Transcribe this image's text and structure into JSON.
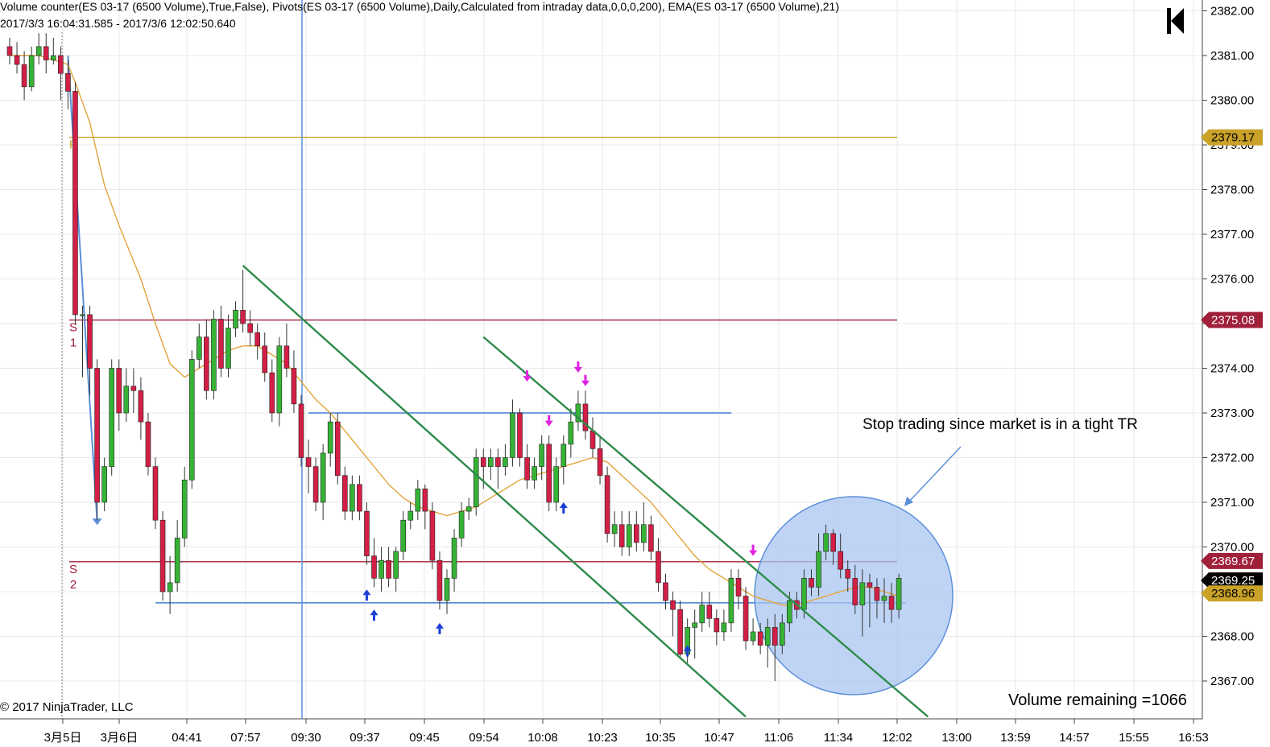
{
  "header": {
    "indicators": "Volume counter(ES 03-17 (6500 Volume),True,False), Pivots(ES 03-17 (6500 Volume),Daily,Calculated from intraday data,0,0,0,200), EMA(ES 03-17 (6500 Volume),21)",
    "range": "2017/3/3 16:04:31.585 - 2017/3/6 12:02:50.640"
  },
  "footer": {
    "copyright": "© 2017 NinjaTrader, LLC",
    "volume_remaining": "Volume remaining =1066"
  },
  "annotation": "Stop trading since market is in a tight TR",
  "logo_icon": "ninjatrader-logo-icon",
  "colors": {
    "up": "#36b336",
    "down": "#d31f46",
    "ema": "#e2a43c",
    "pivot_p": "#c9a227",
    "pivot_s": "#a0203a",
    "blue_line": "#5b8fd9",
    "channel": "#2e8b4b",
    "marker_up": "#1a3fd6",
    "marker_down": "#e020e0",
    "circle_fill": "#a9c6f0",
    "last_price_bg": "#000000"
  },
  "chart_data": {
    "type": "candlestick",
    "symbol": "ES 03-17 (6500 Volume)",
    "y_range": [
      2366.2,
      2382.2
    ],
    "y_ticks": [
      2367,
      2368,
      2369,
      2370,
      2371,
      2372,
      2373,
      2374,
      2375,
      2376,
      2377,
      2378,
      2379,
      2380,
      2381,
      2382
    ],
    "x_ticks": [
      "3月5日",
      "3月6日",
      "04:41",
      "07:57",
      "09:30",
      "09:37",
      "09:45",
      "09:54",
      "10:08",
      "10:23",
      "10:35",
      "10:47",
      "11:06",
      "11:34",
      "12:02",
      "13:00",
      "13:59",
      "14:57",
      "15:55",
      "16:53"
    ],
    "pivots": [
      {
        "label": "P",
        "value": 2379.17
      },
      {
        "label": "S1",
        "value": 2375.08
      },
      {
        "label": "S2",
        "value": 2369.67
      }
    ],
    "price_labels": [
      {
        "value": 2379.17,
        "text": "2379.17",
        "kind": "P"
      },
      {
        "value": 2375.08,
        "text": "2375.08",
        "kind": "S1"
      },
      {
        "value": 2369.67,
        "text": "2369.67",
        "kind": "S2"
      },
      {
        "value": 2369.25,
        "text": "2369.25",
        "kind": "last"
      },
      {
        "value": 2368.96,
        "text": "2368.96",
        "kind": "level"
      }
    ],
    "candles": [
      [
        2381.2,
        2381.0,
        2381.4,
        2380.8
      ],
      [
        2381.0,
        2380.8,
        2381.3,
        2380.6
      ],
      [
        2380.8,
        2380.3,
        2381.1,
        2380.0
      ],
      [
        2380.3,
        2381.0,
        2381.2,
        2380.2
      ],
      [
        2381.0,
        2381.2,
        2381.5,
        2380.8
      ],
      [
        2381.2,
        2380.9,
        2381.5,
        2380.6
      ],
      [
        2380.9,
        2381.0,
        2381.4,
        2380.8
      ],
      [
        2381.0,
        2380.6,
        2381.2,
        2380.0
      ],
      [
        2380.6,
        2380.2,
        2380.9,
        2379.8
      ],
      [
        2380.2,
        2375.2,
        2380.4,
        2375.0
      ],
      [
        2375.2,
        2375.2,
        2375.4,
        2373.8
      ],
      [
        2375.2,
        2374.0,
        2375.4,
        2373.4
      ],
      [
        2374.0,
        2371.0,
        2374.2,
        2370.6
      ],
      [
        2371.0,
        2371.8,
        2372.0,
        2370.8
      ],
      [
        2371.8,
        2374.0,
        2374.2,
        2371.6
      ],
      [
        2374.0,
        2373.0,
        2374.2,
        2372.6
      ],
      [
        2373.0,
        2373.6,
        2374.0,
        2372.8
      ],
      [
        2373.6,
        2373.5,
        2374.0,
        2373.0
      ],
      [
        2373.5,
        2372.8,
        2373.8,
        2372.4
      ],
      [
        2372.8,
        2371.8,
        2373.0,
        2371.6
      ],
      [
        2371.8,
        2370.6,
        2372.0,
        2370.4
      ],
      [
        2370.6,
        2369.0,
        2370.8,
        2368.8
      ],
      [
        2369.0,
        2369.2,
        2369.8,
        2368.5
      ],
      [
        2369.2,
        2370.2,
        2370.6,
        2369.0
      ],
      [
        2370.2,
        2371.5,
        2371.8,
        2370.0
      ],
      [
        2371.5,
        2374.2,
        2374.4,
        2371.3
      ],
      [
        2374.2,
        2374.7,
        2375.0,
        2374.0
      ],
      [
        2374.7,
        2373.5,
        2375.1,
        2373.3
      ],
      [
        2373.5,
        2375.1,
        2375.3,
        2373.3
      ],
      [
        2375.1,
        2374.0,
        2375.4,
        2373.8
      ],
      [
        2374.0,
        2374.9,
        2375.2,
        2373.8
      ],
      [
        2374.9,
        2375.3,
        2375.5,
        2374.7
      ],
      [
        2375.3,
        2375.0,
        2376.2,
        2374.8
      ],
      [
        2375.0,
        2374.8,
        2375.3,
        2374.5
      ],
      [
        2374.8,
        2374.5,
        2375.0,
        2374.2
      ],
      [
        2374.5,
        2373.9,
        2374.8,
        2373.7
      ],
      [
        2373.9,
        2373.0,
        2374.2,
        2372.8
      ],
      [
        2373.0,
        2374.5,
        2374.7,
        2372.7
      ],
      [
        2374.5,
        2374.0,
        2375.0,
        2373.8
      ],
      [
        2374.0,
        2373.2,
        2374.4,
        2373.0
      ],
      [
        2373.2,
        2372.0,
        2373.4,
        2371.8
      ],
      [
        2372.0,
        2371.8,
        2372.4,
        2371.2
      ],
      [
        2371.8,
        2371.0,
        2372.0,
        2370.8
      ],
      [
        2371.0,
        2372.1,
        2372.3,
        2370.6
      ],
      [
        2372.1,
        2372.8,
        2373.0,
        2371.8
      ],
      [
        2372.8,
        2371.6,
        2373.0,
        2371.4
      ],
      [
        2371.6,
        2370.8,
        2371.8,
        2370.6
      ],
      [
        2370.8,
        2371.4,
        2371.6,
        2370.6
      ],
      [
        2371.4,
        2370.8,
        2371.6,
        2370.6
      ],
      [
        2370.8,
        2369.8,
        2371.0,
        2369.6
      ],
      [
        2369.8,
        2369.3,
        2370.2,
        2369.1
      ],
      [
        2369.3,
        2369.7,
        2370.0,
        2369.0
      ],
      [
        2369.7,
        2369.3,
        2370.0,
        2369.1
      ],
      [
        2369.3,
        2369.9,
        2370.0,
        2369.0
      ],
      [
        2369.9,
        2370.6,
        2370.8,
        2369.7
      ],
      [
        2370.6,
        2370.8,
        2371.0,
        2370.4
      ],
      [
        2370.8,
        2371.3,
        2371.5,
        2370.6
      ],
      [
        2371.3,
        2370.8,
        2371.4,
        2370.4
      ],
      [
        2370.8,
        2369.7,
        2371.0,
        2369.5
      ],
      [
        2369.7,
        2368.8,
        2369.9,
        2368.6
      ],
      [
        2368.8,
        2369.3,
        2369.5,
        2368.5
      ],
      [
        2369.3,
        2370.2,
        2370.4,
        2369.0
      ],
      [
        2370.2,
        2370.8,
        2371.0,
        2370.0
      ],
      [
        2370.8,
        2370.9,
        2371.1,
        2370.6
      ],
      [
        2370.9,
        2372.0,
        2372.2,
        2370.7
      ],
      [
        2372.0,
        2371.8,
        2372.2,
        2371.3
      ],
      [
        2371.8,
        2372.0,
        2372.2,
        2371.5
      ],
      [
        2372.0,
        2371.8,
        2372.2,
        2371.3
      ],
      [
        2371.8,
        2372.0,
        2372.3,
        2371.6
      ],
      [
        2372.0,
        2373.0,
        2373.3,
        2371.8
      ],
      [
        2373.0,
        2372.0,
        2373.1,
        2371.8
      ],
      [
        2372.0,
        2371.5,
        2372.3,
        2371.3
      ],
      [
        2371.5,
        2371.8,
        2372.0,
        2371.3
      ],
      [
        2371.8,
        2372.3,
        2372.5,
        2371.5
      ],
      [
        2372.3,
        2371.0,
        2372.5,
        2370.8
      ],
      [
        2371.0,
        2371.8,
        2372.0,
        2370.8
      ],
      [
        2371.8,
        2372.3,
        2372.5,
        2371.4
      ],
      [
        2372.3,
        2372.8,
        2373.1,
        2372.0
      ],
      [
        2372.8,
        2373.2,
        2373.5,
        2372.6
      ],
      [
        2373.2,
        2372.6,
        2373.5,
        2372.4
      ],
      [
        2372.6,
        2372.2,
        2372.9,
        2372.0
      ],
      [
        2372.2,
        2371.6,
        2372.5,
        2371.4
      ],
      [
        2371.6,
        2370.3,
        2371.8,
        2370.1
      ],
      [
        2370.3,
        2370.5,
        2370.8,
        2370.0
      ],
      [
        2370.5,
        2370.0,
        2370.8,
        2369.8
      ],
      [
        2370.0,
        2370.5,
        2370.8,
        2369.8
      ],
      [
        2370.5,
        2370.1,
        2370.8,
        2369.9
      ],
      [
        2370.1,
        2370.5,
        2371.0,
        2369.9
      ],
      [
        2370.5,
        2369.9,
        2370.7,
        2369.7
      ],
      [
        2369.9,
        2369.2,
        2370.2,
        2369.0
      ],
      [
        2369.2,
        2368.8,
        2369.4,
        2368.6
      ],
      [
        2368.8,
        2368.6,
        2369.0,
        2368.0
      ],
      [
        2368.6,
        2367.6,
        2368.8,
        2367.5
      ],
      [
        2367.6,
        2368.2,
        2368.4,
        2367.4
      ],
      [
        2368.2,
        2368.3,
        2368.6,
        2367.5
      ],
      [
        2368.3,
        2368.7,
        2369.0,
        2368.1
      ],
      [
        2368.7,
        2368.4,
        2369.0,
        2368.2
      ],
      [
        2368.4,
        2368.1,
        2368.6,
        2367.8
      ],
      [
        2368.1,
        2368.3,
        2368.6,
        2367.9
      ],
      [
        2368.3,
        2369.3,
        2369.5,
        2368.1
      ],
      [
        2369.3,
        2368.9,
        2369.5,
        2368.6
      ],
      [
        2368.9,
        2367.9,
        2369.1,
        2367.7
      ],
      [
        2367.9,
        2368.1,
        2368.4,
        2367.8
      ],
      [
        2368.1,
        2367.8,
        2368.3,
        2367.6
      ],
      [
        2367.8,
        2368.2,
        2368.4,
        2367.3
      ],
      [
        2368.2,
        2367.8,
        2368.5,
        2367.0
      ],
      [
        2367.8,
        2368.3,
        2368.5,
        2367.6
      ],
      [
        2368.3,
        2368.8,
        2369.0,
        2368.1
      ],
      [
        2368.8,
        2368.6,
        2369.0,
        2368.4
      ],
      [
        2368.6,
        2369.3,
        2369.5,
        2368.4
      ],
      [
        2369.3,
        2369.1,
        2369.5,
        2368.9
      ],
      [
        2369.1,
        2369.9,
        2370.3,
        2368.9
      ],
      [
        2369.9,
        2370.3,
        2370.5,
        2369.7
      ],
      [
        2370.3,
        2369.9,
        2370.4,
        2369.6
      ],
      [
        2369.9,
        2369.5,
        2370.3,
        2369.3
      ],
      [
        2369.5,
        2369.3,
        2369.7,
        2369.0
      ],
      [
        2369.3,
        2368.7,
        2369.6,
        2368.5
      ],
      [
        2368.7,
        2369.2,
        2369.5,
        2368.0
      ],
      [
        2369.2,
        2369.1,
        2369.4,
        2368.2
      ],
      [
        2369.1,
        2368.8,
        2369.3,
        2368.4
      ],
      [
        2368.8,
        2368.9,
        2369.3,
        2368.3
      ],
      [
        2368.9,
        2368.6,
        2369.2,
        2368.3
      ],
      [
        2368.6,
        2369.3,
        2369.4,
        2368.4
      ]
    ],
    "ema_21": [
      [
        0,
        2381.0
      ],
      [
        4,
        2381.0
      ],
      [
        8,
        2380.8
      ],
      [
        9,
        2380.4
      ],
      [
        11,
        2379.5
      ],
      [
        13,
        2378.1
      ],
      [
        15,
        2377.2
      ],
      [
        18,
        2376.0
      ],
      [
        20,
        2375.0
      ],
      [
        22,
        2374.1
      ],
      [
        24,
        2373.8
      ],
      [
        26,
        2374.0
      ],
      [
        28,
        2374.2
      ],
      [
        30,
        2374.4
      ],
      [
        32,
        2374.5
      ],
      [
        34,
        2374.5
      ],
      [
        36,
        2374.3
      ],
      [
        38,
        2374.1
      ],
      [
        40,
        2373.7
      ],
      [
        42,
        2373.3
      ],
      [
        44,
        2373.0
      ],
      [
        46,
        2372.6
      ],
      [
        48,
        2372.2
      ],
      [
        50,
        2371.8
      ],
      [
        52,
        2371.4
      ],
      [
        54,
        2371.1
      ],
      [
        56,
        2370.9
      ],
      [
        58,
        2370.8
      ],
      [
        60,
        2370.7
      ],
      [
        62,
        2370.8
      ],
      [
        64,
        2370.9
      ],
      [
        66,
        2371.1
      ],
      [
        68,
        2371.3
      ],
      [
        70,
        2371.5
      ],
      [
        72,
        2371.6
      ],
      [
        74,
        2371.7
      ],
      [
        76,
        2371.8
      ],
      [
        78,
        2371.9
      ],
      [
        80,
        2372.0
      ],
      [
        82,
        2371.9
      ],
      [
        84,
        2371.6
      ],
      [
        86,
        2371.3
      ],
      [
        88,
        2371.0
      ],
      [
        90,
        2370.6
      ],
      [
        92,
        2370.2
      ],
      [
        94,
        2369.8
      ],
      [
        96,
        2369.5
      ],
      [
        98,
        2369.3
      ],
      [
        100,
        2369.1
      ],
      [
        102,
        2368.9
      ],
      [
        104,
        2368.8
      ],
      [
        106,
        2368.7
      ],
      [
        108,
        2368.7
      ],
      [
        110,
        2368.8
      ],
      [
        112,
        2368.9
      ],
      [
        114,
        2369.0
      ],
      [
        116,
        2369.1
      ],
      [
        118,
        2369.1
      ],
      [
        120,
        2369.0
      ],
      [
        122,
        2368.9
      ]
    ],
    "markers": [
      {
        "bar": 49,
        "dir": "up",
        "y": 2369.05
      },
      {
        "bar": 50,
        "dir": "up",
        "y": 2368.6
      },
      {
        "bar": 59,
        "dir": "up",
        "y": 2368.3
      },
      {
        "bar": 71,
        "dir": "down",
        "y": 2373.7
      },
      {
        "bar": 74,
        "dir": "down",
        "y": 2372.7
      },
      {
        "bar": 76,
        "dir": "up",
        "y": 2371.0
      },
      {
        "bar": 78,
        "dir": "down",
        "y": 2373.9
      },
      {
        "bar": 79,
        "dir": "down",
        "y": 2373.6
      },
      {
        "bar": 93,
        "dir": "up",
        "y": 2367.8
      },
      {
        "bar": 102,
        "dir": "down",
        "y": 2369.8
      }
    ],
    "horizontal_levels": [
      {
        "value": 2368.75,
        "from_bar": 20,
        "to_bar": 123
      },
      {
        "value": 2373.0,
        "from_bar": 41,
        "to_bar": 99
      }
    ],
    "vertical_cursor_bar": 41,
    "channel_lines": [
      {
        "from": [
          32,
          2376.3
        ],
        "to": [
          101,
          2366.2
        ]
      },
      {
        "from": [
          65,
          2374.7
        ],
        "to": [
          126,
          2366.2
        ]
      }
    ]
  }
}
